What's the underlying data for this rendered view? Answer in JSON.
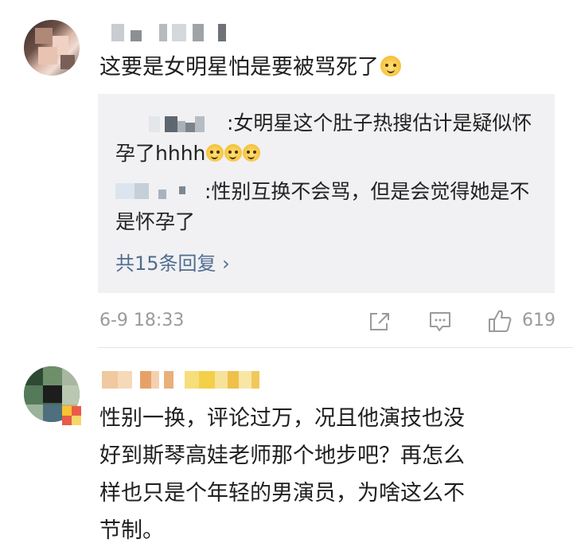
{
  "comment1": {
    "text": "这要是女明星怕是要被骂死了",
    "emoji": "doge-emoji",
    "replies": [
      {
        "text": ":女明星这个肚子热搜估计是疑似怀孕了hhhh",
        "emoji_count": 3
      },
      {
        "text": ":性别互换不会骂，但是会觉得她是不是怀孕了"
      }
    ],
    "more_replies": "共15条回复 ›",
    "timestamp": "6-9 18:33",
    "like_count": "619"
  },
  "comment2": {
    "lines": [
      "性别一换，评论过万，况且他演技也没",
      "好到斯琴高娃老师那个地步吧？再怎么",
      "样也只是个年轻的男演员，为啥这么不",
      "节制。"
    ]
  },
  "colors": {
    "link": "#4f6d91",
    "meta": "#9a9a9a",
    "reply_bg": "#f1f1f3"
  }
}
